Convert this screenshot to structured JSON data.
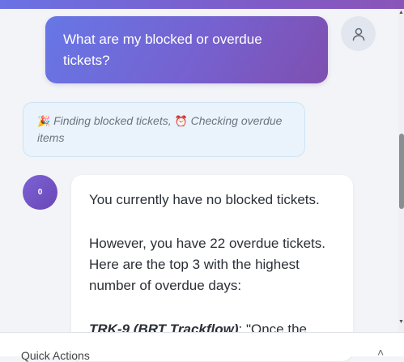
{
  "user_message": {
    "text": "What are my blocked or overdue tickets?"
  },
  "status": {
    "step1_emoji": "🎉",
    "step1_text": "Finding blocked tickets,",
    "step2_emoji": "⏰",
    "step2_text": "Checking overdue items"
  },
  "bot": {
    "avatar_text": "0",
    "para1": "You currently have no blocked tickets.",
    "para2": "However, you have 22 overdue tickets. Here are the top 3 with the highest number of overdue days:",
    "ticket1_key": "TRK-9 (BRT Trackflow)",
    "ticket1_rest": ": \"Once the"
  },
  "bottom": {
    "label": "Quick Actions"
  },
  "colors": {
    "accent_start": "#6777e6",
    "accent_end": "#7f4fb0",
    "status_bg": "#eaf3fb"
  }
}
